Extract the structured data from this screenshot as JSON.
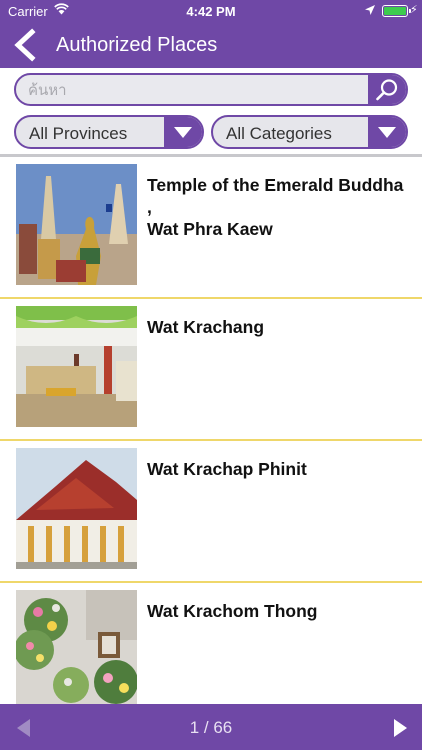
{
  "status": {
    "carrier": "Carrier",
    "time": "4:42 PM"
  },
  "nav": {
    "title": "Authorized Places"
  },
  "search": {
    "placeholder": "ค้นหา"
  },
  "filters": {
    "province": "All Provinces",
    "category": "All Categories"
  },
  "places": [
    {
      "name": "Temple of the Emerald Buddha ,\nWat Phra Kaew",
      "image": "temple-photo"
    },
    {
      "name": "Wat Krachang",
      "image": "hall-photo"
    },
    {
      "name": "Wat Krachap Phinit",
      "image": "temple-photo"
    },
    {
      "name": "Wat Krachom Thong",
      "image": "flowers-photo"
    }
  ],
  "pager": {
    "label": "1 / 66"
  },
  "colors": {
    "brand": "#6f48a6",
    "divider": "#efd76a",
    "battery": "#3ecb4f"
  }
}
